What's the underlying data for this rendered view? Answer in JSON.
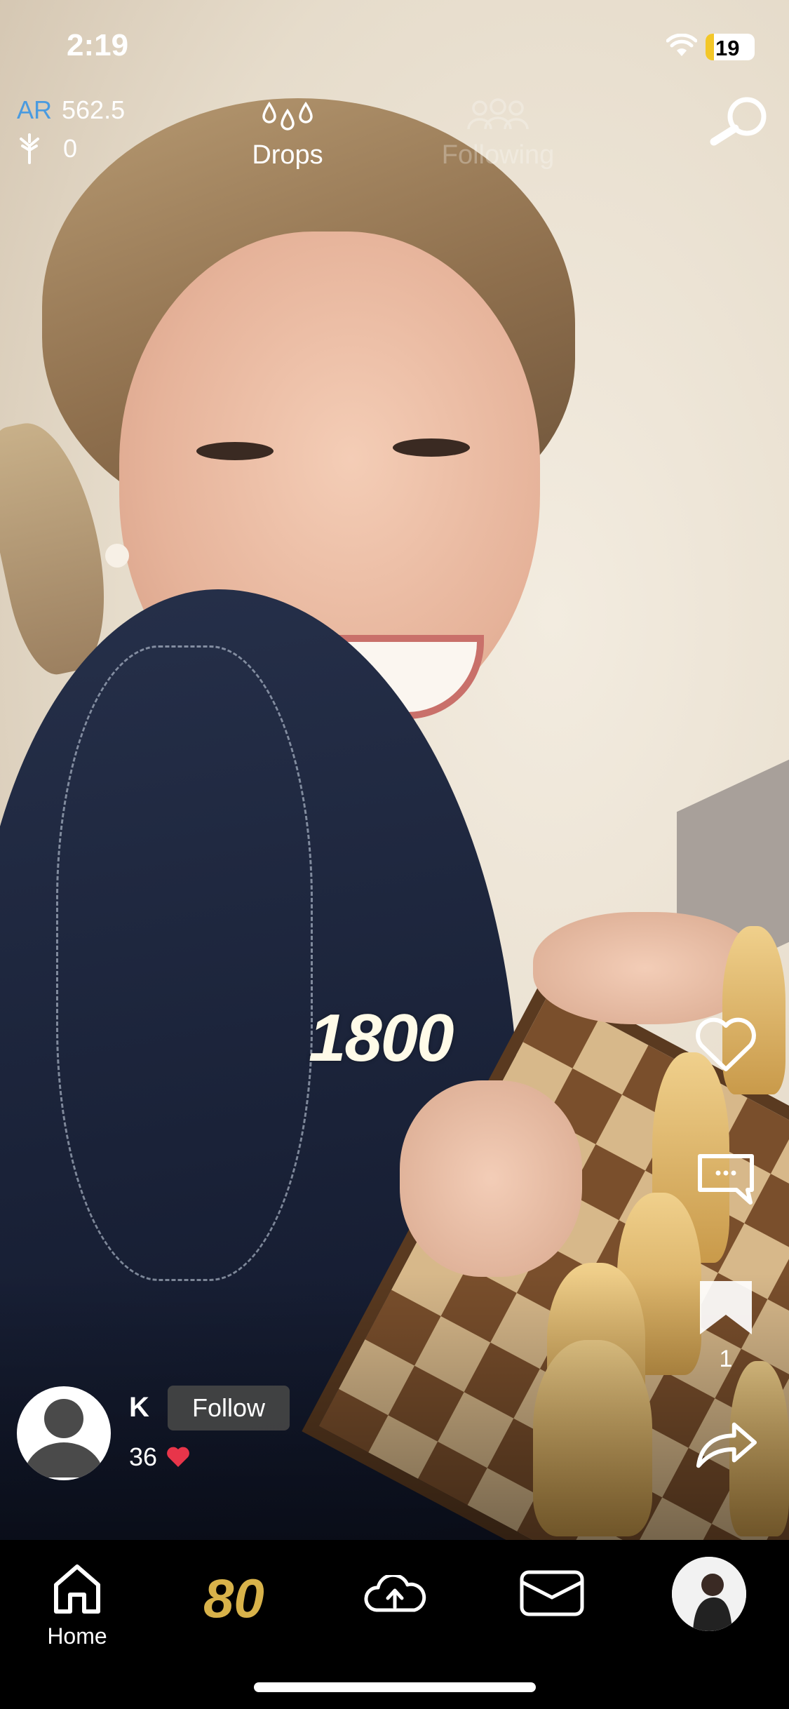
{
  "status_bar": {
    "time": "2:19",
    "battery_level": "19",
    "battery_color": "#f3c728"
  },
  "top": {
    "ar_label": "AR",
    "ar_value": "562.5",
    "tree_count": "0",
    "tabs": [
      {
        "label": "Drops",
        "active": true
      },
      {
        "label": "Following",
        "active": false
      }
    ],
    "search_icon": "search-icon"
  },
  "video": {
    "caption": "1800"
  },
  "actions": {
    "bookmark_count": "1"
  },
  "author": {
    "name": "K",
    "follow_label": "Follow",
    "likes": "36"
  },
  "nav": {
    "home_label": "Home",
    "eighty_label": "80",
    "items": [
      "home-icon",
      "eighty-icon",
      "upload-cloud-icon",
      "inbox-icon",
      "profile-avatar"
    ]
  },
  "colors": {
    "accent_blue": "#4a9be0",
    "heart_red": "#e8354a",
    "gold": "#d8b24a"
  }
}
